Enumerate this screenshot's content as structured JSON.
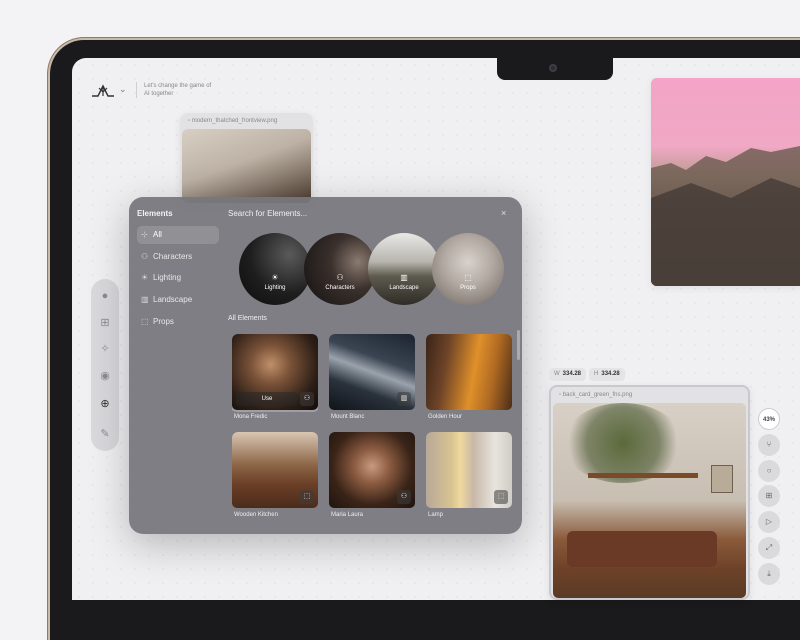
{
  "header": {
    "tagline": "Let's change the game of AI together",
    "logo_icon": "brand-logo-icon",
    "menu_icon": "chevron-down-icon"
  },
  "canvas_cards": {
    "top_left": {
      "filename": "modern_thatched_frontview.png"
    },
    "bottom_right": {
      "filename": "back_card_green_fns.png"
    }
  },
  "dimensions": {
    "w_label": "W",
    "w_value": "334.28",
    "h_label": "H",
    "h_value": "334.28"
  },
  "right_toolbar": {
    "zoom": "43%"
  },
  "modal": {
    "sidebar_title": "Elements",
    "search_placeholder": "Search for Elements...",
    "close": "×",
    "sidebar": [
      {
        "label": "All",
        "icon": "all-icon"
      },
      {
        "label": "Characters",
        "icon": "characters-icon"
      },
      {
        "label": "Lighting",
        "icon": "lighting-icon"
      },
      {
        "label": "Landscape",
        "icon": "landscape-icon"
      },
      {
        "label": "Props",
        "icon": "props-icon"
      }
    ],
    "categories": [
      {
        "label": "Lighting",
        "icon": "lighting-icon"
      },
      {
        "label": "Characters",
        "icon": "characters-icon"
      },
      {
        "label": "Landscape",
        "icon": "landscape-icon"
      },
      {
        "label": "Props",
        "icon": "props-icon"
      }
    ],
    "all_elements_label": "All Elements",
    "use_label": "Use",
    "elements": [
      {
        "label": "Mona Fredic",
        "icon": "characters-icon"
      },
      {
        "label": "Mount Blanc",
        "icon": "landscape-icon"
      },
      {
        "label": "Golden Hour",
        "icon": "lighting-icon"
      },
      {
        "label": "Wooden Kitchen",
        "icon": "props-icon"
      },
      {
        "label": "Maria Laura",
        "icon": "characters-icon"
      },
      {
        "label": "Lamp",
        "icon": "props-icon"
      }
    ]
  },
  "colors": {
    "modal_bg": "#76767c",
    "canvas_bg": "#f0f0f2",
    "bezel": "#1a1a1c",
    "pink_sky": "#f4a4c6"
  }
}
